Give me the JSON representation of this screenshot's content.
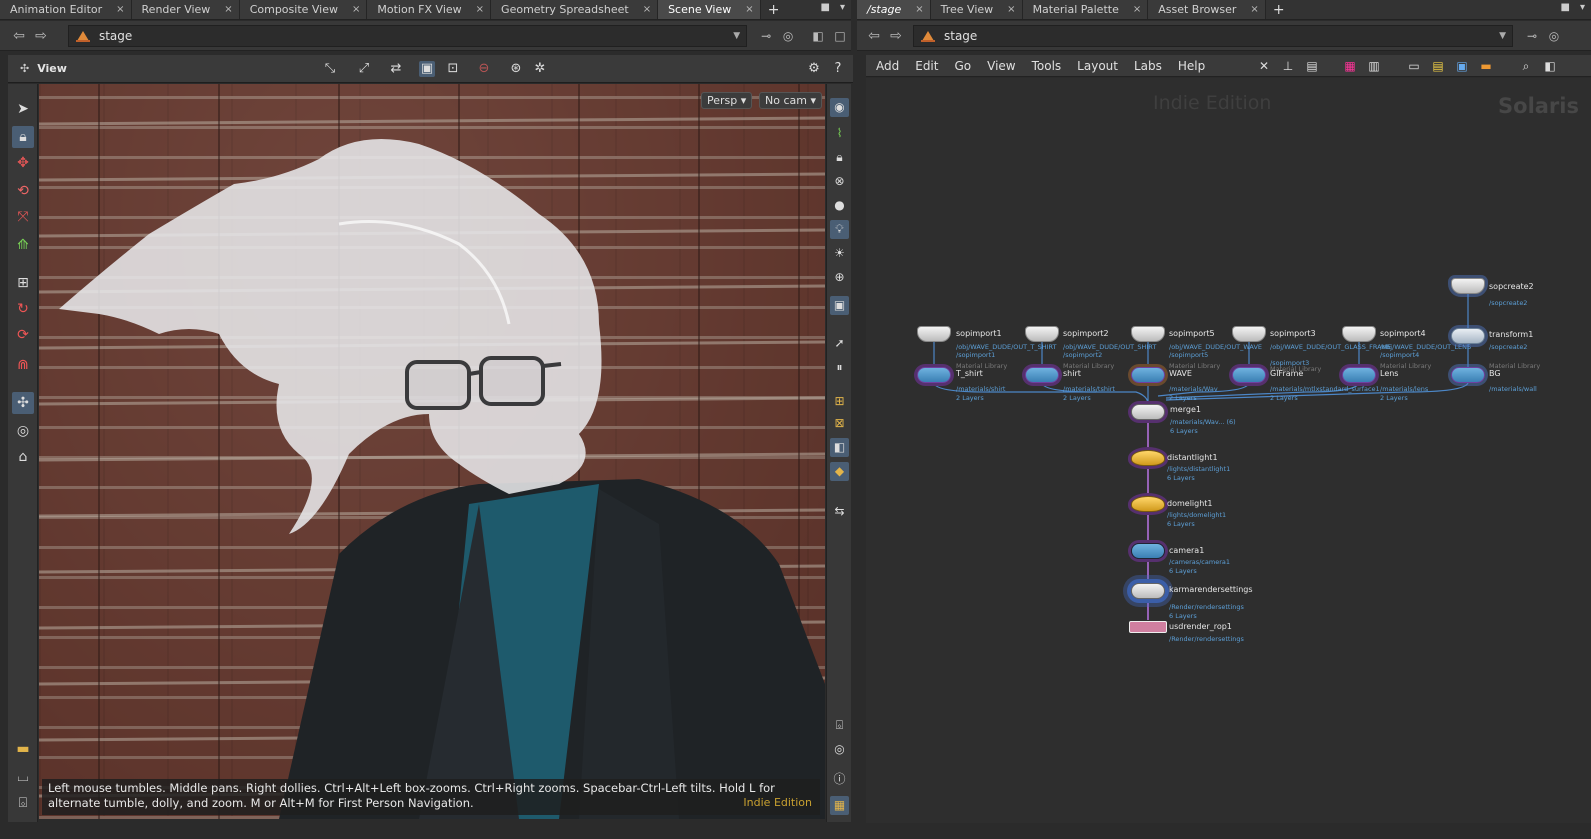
{
  "left_tabs": [
    {
      "label": "Animation Editor",
      "active": false
    },
    {
      "label": "Render View",
      "active": false
    },
    {
      "label": "Composite View",
      "active": false
    },
    {
      "label": "Motion FX View",
      "active": false
    },
    {
      "label": "Geometry Spreadsheet",
      "active": false
    },
    {
      "label": "Scene View",
      "active": true
    }
  ],
  "right_tabs": [
    {
      "label": "/stage",
      "active": true
    },
    {
      "label": "Tree View",
      "active": false
    },
    {
      "label": "Material Palette",
      "active": false
    },
    {
      "label": "Asset Browser",
      "active": false
    }
  ],
  "tab_close_glyph": "×",
  "tab_add_glyph": "+",
  "left_path": "stage",
  "right_path": "stage",
  "view_label": "View",
  "viewport": {
    "persp_label": "Persp ▾",
    "cam_label": "No cam ▾"
  },
  "status": {
    "text": "Left mouse tumbles. Middle pans. Right dollies. Ctrl+Alt+Left box-zooms. Ctrl+Right zooms. Spacebar-Ctrl-Left tilts. Hold L for alternate tumble, dolly, and zoom.    M or Alt+M for First Person Navigation.",
    "watermark": "Indie Edition"
  },
  "network_menu": [
    "Add",
    "Edit",
    "Go",
    "View",
    "Tools",
    "Layout",
    "Labs",
    "Help"
  ],
  "network_watermark": {
    "edition": "Indie Edition",
    "context": "Solaris"
  },
  "nodes": {
    "sopimport1": {
      "name": "sopimport1",
      "path": "/obj/WAVE_DUDE/OUT_T_SHIRT",
      "sub": "/sopimport1"
    },
    "sopimport2": {
      "name": "sopimport2",
      "path": "/obj/WAVE_DUDE/OUT_SHIRT",
      "sub": "/sopimport2"
    },
    "sopimport5": {
      "name": "sopimport5",
      "path": "/obj/WAVE_DUDE/OUT_WAVE",
      "sub": "/sopimport5"
    },
    "sopimport3": {
      "name": "sopimport3",
      "path": "/obj/WAVE_DUDE/OUT_GLASS_FRAME",
      "sub": "/sopimport3"
    },
    "sopimport4": {
      "name": "sopimport4",
      "path": "/obj/WAVE_DUDE/OUT_LENS",
      "sub": "/sopimport4"
    },
    "sopcreate2": {
      "name": "sopcreate2",
      "sub": "/sopcreate2"
    },
    "transform1": {
      "name": "transform1",
      "sub": "/sopcreate2"
    },
    "mat_tshirt": {
      "name": "T_shirt",
      "lib": "Material Library",
      "path": "/materials/shirt",
      "layers": "2 Layers"
    },
    "mat_shirt": {
      "name": "shirt",
      "lib": "Material Library",
      "path": "/materials/tshirt",
      "layers": "2 Layers"
    },
    "mat_wave": {
      "name": "WAVE",
      "lib": "Material Library",
      "path": "/materials/Wav",
      "layers": "2 Layers"
    },
    "mat_glframe": {
      "name": "GlFrame",
      "lib": "Material Library",
      "path": "/materials/mtlxstandard_surface1",
      "layers": "2 Layers"
    },
    "mat_lens": {
      "name": "Lens",
      "lib": "Material Library",
      "path": "/materials/lens",
      "layers": "2 Layers"
    },
    "mat_bg": {
      "name": "BG",
      "lib": "Material Library",
      "path": "/materials/wall"
    },
    "merge1": {
      "name": "merge1",
      "path": "/materials/Wav... (6)",
      "layers": "6 Layers"
    },
    "distantlight1": {
      "name": "distantlight1",
      "path": "/lights/distantlight1",
      "layers": "6 Layers"
    },
    "domelight1": {
      "name": "domelight1",
      "path": "/lights/domelight1",
      "layers": "6 Layers"
    },
    "camera1": {
      "name": "camera1",
      "path": "/cameras/camera1",
      "layers": "6 Layers"
    },
    "karma": {
      "name": "karmarendersettings",
      "path": "/Render/rendersettings",
      "layers": "6 Layers"
    },
    "rop": {
      "name": "usdrender_rop1",
      "path": "/Render/rendersettings"
    }
  }
}
